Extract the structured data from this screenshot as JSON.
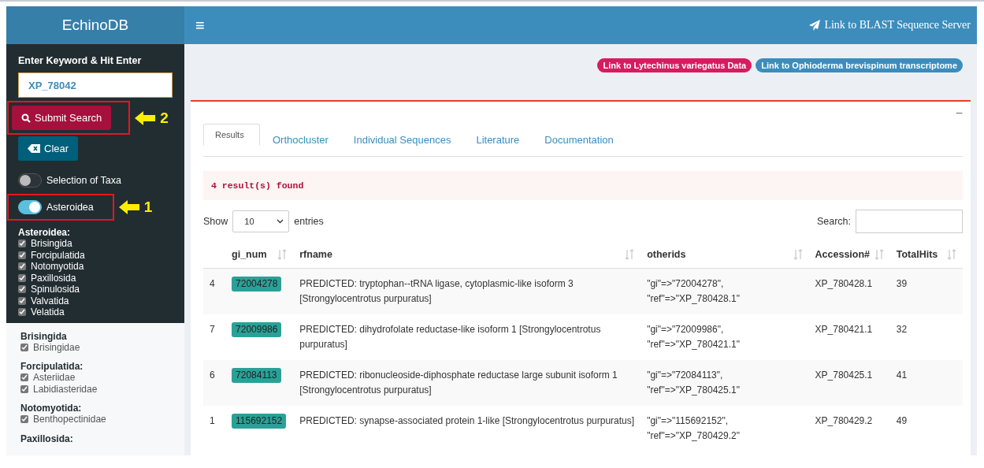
{
  "sidebar": {
    "brand": "EchinoDB",
    "search_label": "Enter Keyword & Hit Enter",
    "search_value": "XP_78042",
    "submit": {
      "label": "Submit Search",
      "callout": "2"
    },
    "clear": {
      "label": "Clear"
    },
    "toggles": [
      {
        "label": "Selection of Taxa",
        "on": false
      },
      {
        "label": "Asteroidea",
        "on": true,
        "callout": "1"
      }
    ],
    "dark_group": {
      "title": "Asteroidea:",
      "items": [
        {
          "label": "Brisingida",
          "checked": true
        },
        {
          "label": "Forcipulatida",
          "checked": true
        },
        {
          "label": "Notomyotida",
          "checked": true
        },
        {
          "label": "Paxillosida",
          "checked": true
        },
        {
          "label": "Spinulosida",
          "checked": true
        },
        {
          "label": "Valvatida",
          "checked": true
        },
        {
          "label": "Velatida",
          "checked": true
        }
      ]
    },
    "groups": [
      {
        "title": "Brisingida",
        "items": [
          {
            "label": "Brisingidae",
            "checked": true
          }
        ]
      },
      {
        "title": "Forcipulatida:",
        "items": [
          {
            "label": "Asteriidae",
            "checked": true
          },
          {
            "label": "Labidiasteridae",
            "checked": true
          }
        ]
      },
      {
        "title": "Notomyotida:",
        "items": [
          {
            "label": "Benthopectinidae",
            "checked": true
          }
        ]
      },
      {
        "title": "Paxillosida:"
      }
    ]
  },
  "header": {
    "menu_icon": "≡",
    "blast_link": "Link to BLAST Sequence Server"
  },
  "badges": [
    {
      "label": "Link to Lytechinus variegatus Data",
      "color": "#d81b60"
    },
    {
      "label": "Link to Ophioderma brevispinum transcriptome",
      "color": "#3c8dbc"
    }
  ],
  "panel": {
    "collapse": "−",
    "tabs": [
      {
        "label": "Results",
        "selected": true
      },
      {
        "label": "Orthocluster",
        "selected": false
      },
      {
        "label": "Individual Sequences",
        "selected": false
      },
      {
        "label": "Literature",
        "selected": false
      },
      {
        "label": "Documentation",
        "selected": false
      }
    ],
    "message": "4 result(s) found",
    "show_label": "Show",
    "page_size": "10",
    "entries_label": "entries",
    "search_label": "Search:",
    "table": {
      "columns": [
        "",
        "gi_num",
        "rfname",
        "otherids",
        "Accession#",
        "TotalHits"
      ],
      "rows": [
        [
          "4",
          "72004278",
          "PREDICTED: tryptophan--tRNA ligase, cytoplasmic-like isoform 3 [Strongylocentrotus purpuratus]",
          "\"gi\"=>\"72004278\", \"ref\"=>\"XP_780428.1\"",
          "XP_780428.1",
          "39"
        ],
        [
          "7",
          "72009986",
          "PREDICTED: dihydrofolate reductase-like isoform 1 [Strongylocentrotus purpuratus]",
          "\"gi\"=>\"72009986\", \"ref\"=>\"XP_780421.1\"",
          "XP_780421.1",
          "32"
        ],
        [
          "6",
          "72084113",
          "PREDICTED: ribonucleoside-diphosphate reductase large subunit isoform 1 [Strongylocentrotus purpuratus]",
          "\"gi\"=>\"72084113\", \"ref\"=>\"XP_780425.1\"",
          "XP_780425.1",
          "41"
        ],
        [
          "1",
          "115692152",
          "PREDICTED: synapse-associated protein 1-like [Strongylocentrotus purpuratus]",
          "\"gi\"=>\"115692152\", \"ref\"=>\"XP_780429.2\"",
          "XP_780429.2",
          "49"
        ]
      ]
    }
  }
}
